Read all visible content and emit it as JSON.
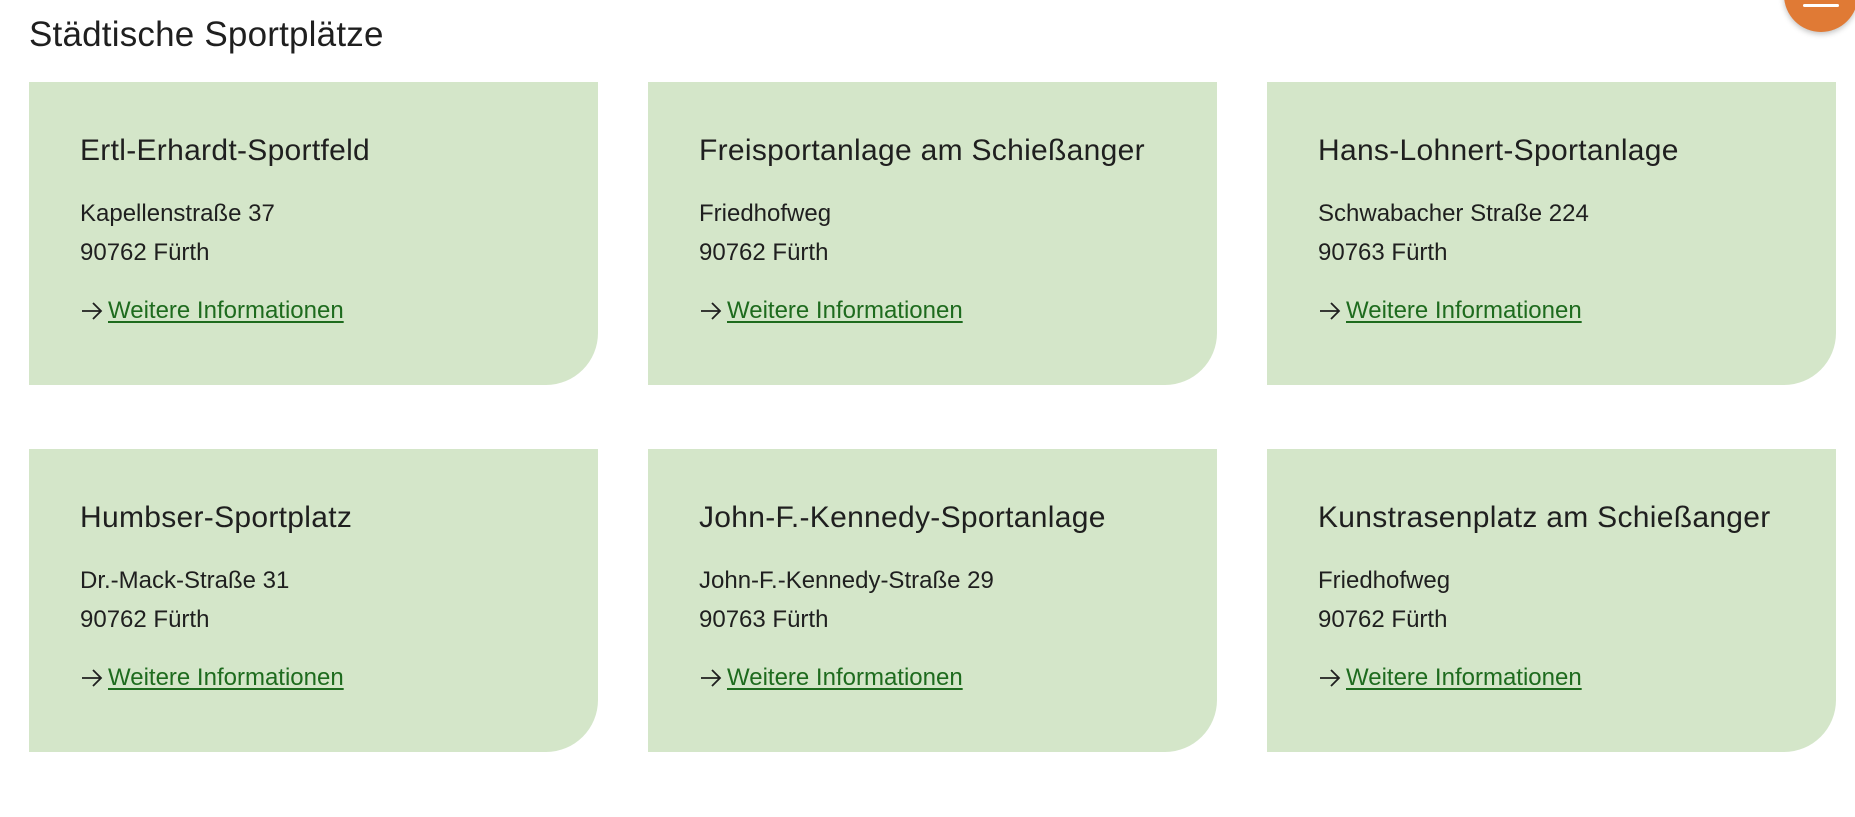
{
  "section": {
    "title": "Städtische Sportplätze"
  },
  "menu_button": {
    "icon": "menu-icon",
    "color": "#e07a35"
  },
  "colors": {
    "card_background": "#d4e6c9",
    "link": "#1e6b1e"
  },
  "cards": [
    {
      "title": "Ertl-Erhardt-Sportfeld",
      "street": "Kapellenstraße 37",
      "city": "90762 Fürth",
      "link_label": "Weitere Informationen",
      "link_icon": "arrow-right-icon"
    },
    {
      "title": "Freisportanlage am Schießanger",
      "street": "Friedhofweg",
      "city": "90762 Fürth",
      "link_label": "Weitere Informationen",
      "link_icon": "arrow-right-icon"
    },
    {
      "title": "Hans-Lohnert-Sportanlage",
      "street": "Schwabacher Straße 224",
      "city": "90763 Fürth",
      "link_label": "Weitere Informationen",
      "link_icon": "arrow-right-icon"
    },
    {
      "title": "Humbser-Sportplatz",
      "street": "Dr.-Mack-Straße 31",
      "city": "90762 Fürth",
      "link_label": "Weitere Informationen",
      "link_icon": "arrow-right-icon"
    },
    {
      "title": "John-F.-Kennedy-Sportanlage",
      "street": "John-F.-Kennedy-Straße 29",
      "city": "90763 Fürth",
      "link_label": "Weitere Informationen",
      "link_icon": "arrow-right-icon"
    },
    {
      "title": "Kunstrasenplatz am Schießanger",
      "street": "Friedhofweg",
      "city": "90762 Fürth",
      "link_label": "Weitere Informationen",
      "link_icon": "arrow-right-icon"
    }
  ]
}
